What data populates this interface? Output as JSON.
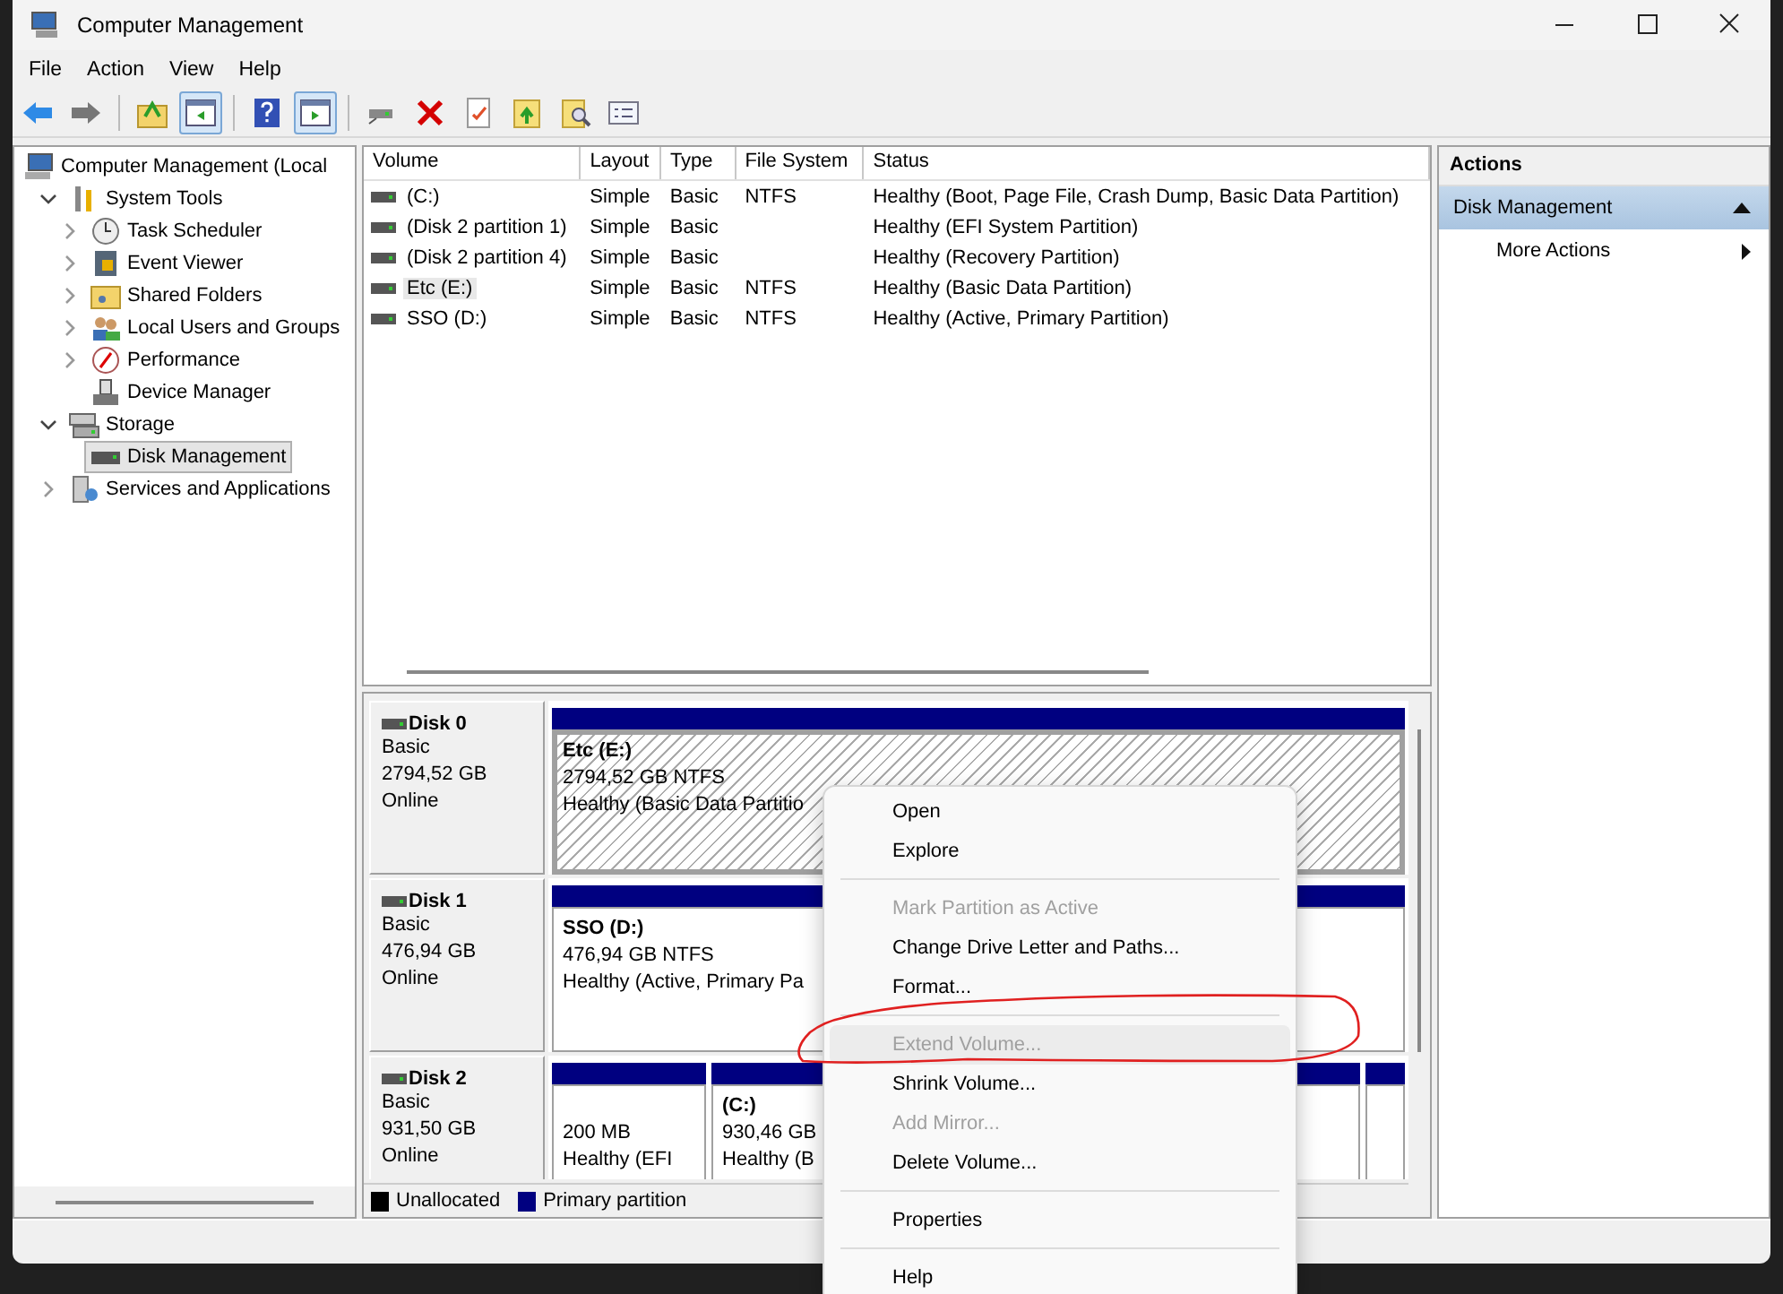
{
  "window": {
    "title": "Computer Management"
  },
  "menu": [
    "File",
    "Action",
    "View",
    "Help"
  ],
  "toolbar": [
    {
      "kind": "back",
      "on": false
    },
    {
      "kind": "forward",
      "on": false
    },
    {
      "kind": "up",
      "on": false
    },
    {
      "kind": "tree",
      "on": true
    },
    {
      "kind": "help",
      "on": false
    },
    {
      "kind": "pane",
      "on": true
    },
    {
      "kind": "connect",
      "on": false
    },
    {
      "kind": "delete",
      "on": false
    },
    {
      "kind": "check",
      "on": false
    },
    {
      "kind": "upload",
      "on": false
    },
    {
      "kind": "find",
      "on": false
    },
    {
      "kind": "list",
      "on": false
    }
  ],
  "tree": [
    {
      "label": "Computer Management (Local",
      "kind": "computer",
      "selected": false,
      "children": [
        {
          "label": "System Tools",
          "kind": "tools",
          "expanded": true,
          "selected": false,
          "children": [
            {
              "label": "Task Scheduler",
              "kind": "clock",
              "expanded": false,
              "selected": false
            },
            {
              "label": "Event Viewer",
              "kind": "viewer",
              "expanded": false,
              "selected": false
            },
            {
              "label": "Shared Folders",
              "kind": "folder",
              "expanded": false,
              "selected": false
            },
            {
              "label": "Local Users and Groups",
              "kind": "users",
              "expanded": false,
              "selected": false
            },
            {
              "label": "Performance",
              "kind": "perf",
              "expanded": false,
              "selected": false
            },
            {
              "label": "Device Manager",
              "kind": "device",
              "selected": false
            }
          ]
        },
        {
          "label": "Storage",
          "kind": "storage",
          "expanded": true,
          "selected": false,
          "children": [
            {
              "label": "Disk Management",
              "kind": "disk",
              "selected": true
            }
          ]
        },
        {
          "label": "Services and Applications",
          "kind": "services",
          "expanded": false,
          "selected": false
        }
      ]
    }
  ],
  "volumes": {
    "columns": [
      "Volume",
      "Layout",
      "Type",
      "File System",
      "Status"
    ],
    "rows": [
      {
        "cells": [
          "(C:)",
          "Simple",
          "Basic",
          "NTFS",
          "Healthy (Boot, Page File, Crash Dump, Basic Data Partition)"
        ],
        "selected": false
      },
      {
        "cells": [
          "(Disk 2 partition 1)",
          "Simple",
          "Basic",
          "",
          "Healthy (EFI System Partition)"
        ],
        "selected": false
      },
      {
        "cells": [
          "(Disk 2 partition 4)",
          "Simple",
          "Basic",
          "",
          "Healthy (Recovery Partition)"
        ],
        "selected": false
      },
      {
        "cells": [
          "Etc (E:)",
          "Simple",
          "Basic",
          "NTFS",
          "Healthy (Basic Data Partition)"
        ],
        "selected": true
      },
      {
        "cells": [
          "SSO (D:)",
          "Simple",
          "Basic",
          "NTFS",
          "Healthy (Active, Primary Partition)"
        ],
        "selected": false
      }
    ]
  },
  "disks": [
    {
      "name": "Disk 0",
      "type": "Basic",
      "size": "2794,52 GB",
      "status": "Online",
      "partitions": [
        {
          "label": "Etc  (E:)",
          "detail": "2794,52 GB NTFS",
          "status": "Healthy (Basic Data Partitio",
          "selected": true
        }
      ]
    },
    {
      "name": "Disk 1",
      "type": "Basic",
      "size": "476,94 GB",
      "status": "Online",
      "partitions": [
        {
          "label": "SSO  (D:)",
          "detail": "476,94 GB NTFS",
          "status": "Healthy (Active, Primary Pa",
          "selected": false
        }
      ]
    },
    {
      "name": "Disk 2",
      "type": "Basic",
      "size": "931,50 GB",
      "status": "Online",
      "partitions": [
        {
          "detail": "200 MB",
          "status": "Healthy (EFI",
          "selected": false
        },
        {
          "label": "(C:)",
          "detail": "930,46 GB",
          "status": "Healthy (B",
          "selected": false
        },
        {
          "selected": false
        }
      ]
    }
  ],
  "legend": [
    {
      "label": "Unallocated",
      "color": "#000000"
    },
    {
      "label": "Primary partition",
      "color": "#000080"
    }
  ],
  "actions": {
    "title": "Actions",
    "section": "Disk Management",
    "items": [
      "More Actions"
    ]
  },
  "context_menu": [
    {
      "kind": "item",
      "label": "Open",
      "disabled": false,
      "selected": false
    },
    {
      "kind": "item",
      "label": "Explore",
      "disabled": false,
      "selected": false
    },
    {
      "kind": "separator"
    },
    {
      "kind": "item",
      "label": "Mark Partition as Active",
      "disabled": true,
      "selected": false
    },
    {
      "kind": "item",
      "label": "Change Drive Letter and Paths...",
      "disabled": false,
      "selected": false
    },
    {
      "kind": "item",
      "label": "Format...",
      "disabled": false,
      "selected": false
    },
    {
      "kind": "separator"
    },
    {
      "kind": "item",
      "label": "Extend Volume...",
      "disabled": true,
      "selected": true
    },
    {
      "kind": "item",
      "label": "Shrink Volume...",
      "disabled": false,
      "selected": false
    },
    {
      "kind": "item",
      "label": "Add Mirror...",
      "disabled": true,
      "selected": false
    },
    {
      "kind": "item",
      "label": "Delete Volume...",
      "disabled": false,
      "selected": false
    },
    {
      "kind": "separator"
    },
    {
      "kind": "item",
      "label": "Properties",
      "disabled": false,
      "selected": false
    },
    {
      "kind": "separator"
    },
    {
      "kind": "item",
      "label": "Help",
      "disabled": false,
      "selected": false
    }
  ]
}
